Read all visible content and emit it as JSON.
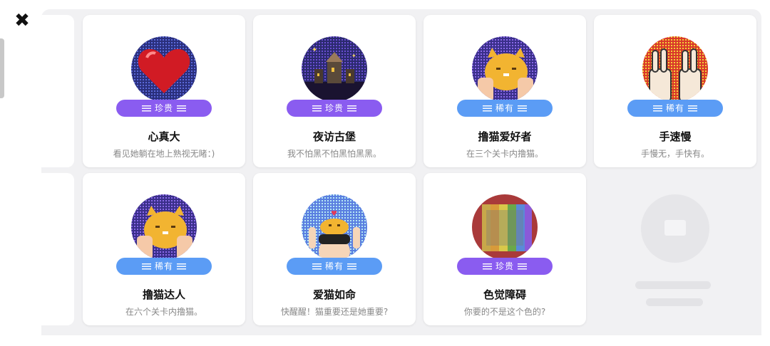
{
  "close_icon": "close-icon",
  "tags": {
    "precious": "珍贵",
    "rare": "稀有"
  },
  "colors": {
    "precious": "#8a5cf0",
    "rare": "#5b9cf5",
    "panel": "#f1f1f3"
  },
  "cards": [
    {
      "title": "心真大",
      "desc": "看见她躺在地上熟视无睹：)",
      "tag": "珍贵",
      "icon": "heart-badge-icon"
    },
    {
      "title": "夜访古堡",
      "desc": "我不怕黑不怕黑怕黑黑。",
      "tag": "珍贵",
      "icon": "castle-badge-icon"
    },
    {
      "title": "撸猫爱好者",
      "desc": "在三个关卡内撸猫。",
      "tag": "稀有",
      "icon": "cat-badge-icon"
    },
    {
      "title": "手速慢",
      "desc": "手慢无，手快有。",
      "tag": "稀有",
      "icon": "peace-hands-badge-icon"
    },
    {
      "title": "撸猫达人",
      "desc": "在六个关卡内撸猫。",
      "tag": "稀有",
      "icon": "cat-badge-icon"
    },
    {
      "title": "爱猫如命",
      "desc": "快醒醒！猫重要还是她重要?",
      "tag": "稀有",
      "icon": "cat-on-head-badge-icon"
    },
    {
      "title": "色觉障碍",
      "desc": "你要的不是这个色的?",
      "tag": "珍贵",
      "icon": "color-bars-badge-icon"
    }
  ],
  "placeholder_icon": "locked-badge-icon"
}
